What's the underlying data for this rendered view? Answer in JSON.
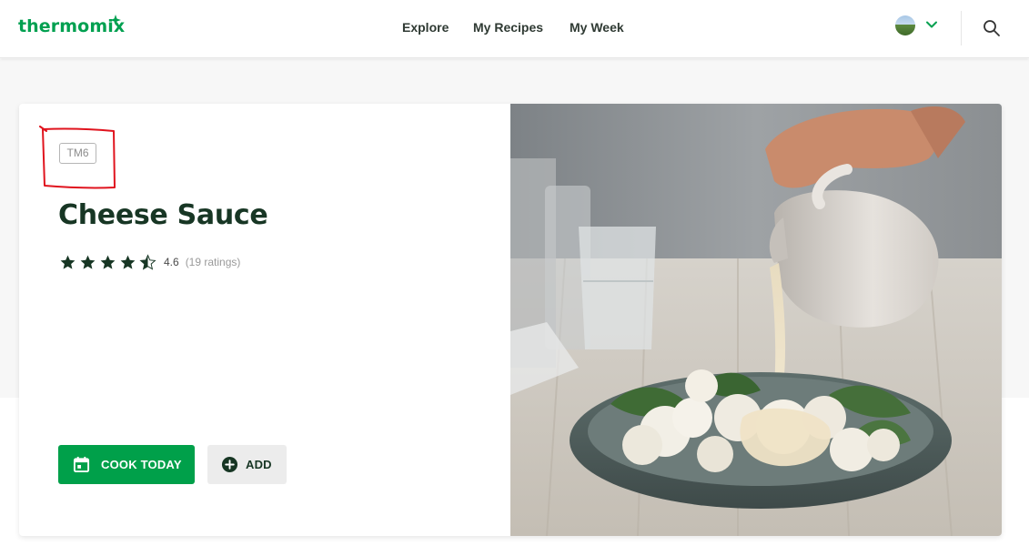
{
  "header": {
    "logo": "thermomix",
    "nav": {
      "explore": "Explore",
      "my_recipes": "My Recipes",
      "my_week": "My Week"
    },
    "user_icon": "avatar",
    "chevron_icon": "chevron-down-icon",
    "search_icon": "search-icon"
  },
  "recipe": {
    "device_badge": "TM6",
    "title": "Cheese Sauce",
    "rating": {
      "value": "4.6",
      "count": "(19 ratings)",
      "stars": 4.6,
      "max_stars": 5
    },
    "actions": {
      "cook_today": "COOK TODAY",
      "add": "ADD"
    }
  },
  "colors": {
    "brand_green": "#00a050",
    "dark_green": "#173624",
    "button_green": "#00a04a",
    "annotation_red": "#e0141e"
  }
}
